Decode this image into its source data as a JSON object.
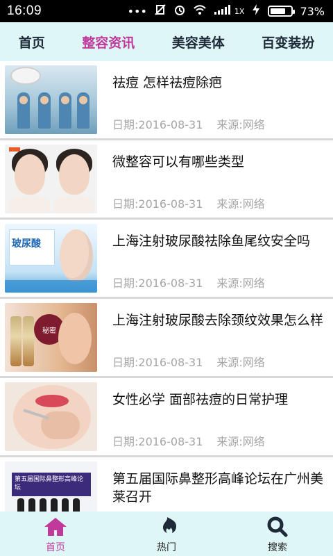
{
  "status_bar": {
    "time": "16:09",
    "icons": [
      "more-dots-icon",
      "mute-vibrate-icon",
      "alarm-icon",
      "wifi-icon",
      "signal-icon",
      "charging-icon"
    ],
    "signal_label": "1X",
    "battery_percent": "73%",
    "battery_level": 0.73
  },
  "top_tabs": [
    {
      "label": "首页",
      "active": false
    },
    {
      "label": "整容资讯",
      "active": true
    },
    {
      "label": "美容美体",
      "active": false
    },
    {
      "label": "百变装扮",
      "active": false
    }
  ],
  "articles": [
    {
      "title": "祛痘 怎样祛痘除疤",
      "date": "日期:2016-08-31",
      "source": "来源:网络"
    },
    {
      "title": "微整容可以有哪些类型",
      "date": "日期:2016-08-31",
      "source": "来源:网络"
    },
    {
      "title": "上海注射玻尿酸祛除鱼尾纹安全吗",
      "date": "日期:2016-08-31",
      "source": "来源:网络"
    },
    {
      "title": "上海注射玻尿酸去除颈纹效果怎么样",
      "date": "日期:2016-08-31",
      "source": "来源:网络"
    },
    {
      "title": "女性必学 面部祛痘的日常护理",
      "date": "日期:2016-08-31",
      "source": "来源:网络"
    },
    {
      "title": "第五届国际鼻整形高峰论坛在广州美莱召开",
      "date": "",
      "source": ""
    }
  ],
  "thumb_text": {
    "t3_label": "玻尿酸",
    "t4_seal": "秘密",
    "t6_banner": "第五届国际鼻整形高峰论坛"
  },
  "bottom_nav": [
    {
      "label": "首页",
      "icon": "home-icon",
      "active": true
    },
    {
      "label": "热门",
      "icon": "flame-icon",
      "active": false
    },
    {
      "label": "搜索",
      "icon": "search-icon",
      "active": false
    }
  ],
  "colors": {
    "accent": "#c03a9c",
    "tabbar_bg": "#dff6f6",
    "meta_text": "#a6a6a6"
  }
}
